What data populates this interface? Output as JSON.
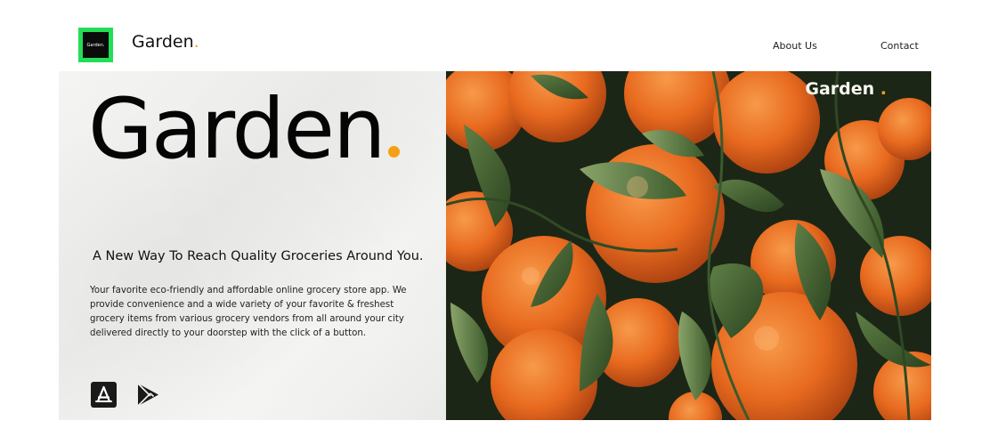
{
  "header": {
    "logo_text": "Garden.",
    "brand_name": "Garden",
    "brand_dot": ".",
    "nav": [
      {
        "label": "About Us"
      },
      {
        "label": "Contact"
      }
    ]
  },
  "hero": {
    "title": "Garden",
    "tagline": "A New Way To Reach Quality Groceries Around You.",
    "description": "Your favorite eco-friendly and affordable online grocery store app. We provide convenience and a wide variety of your favorite & freshest grocery items from various grocery vendors from all around your city delivered directly to your doorstep with the click of a button.",
    "image_label": "Garden",
    "image_label_dot": ".",
    "store_icons": [
      "app-store-icon",
      "google-play-icon"
    ]
  },
  "colors": {
    "accent_green": "#22dd55",
    "accent_orange": "#f5a014",
    "text_dark": "#050505"
  }
}
